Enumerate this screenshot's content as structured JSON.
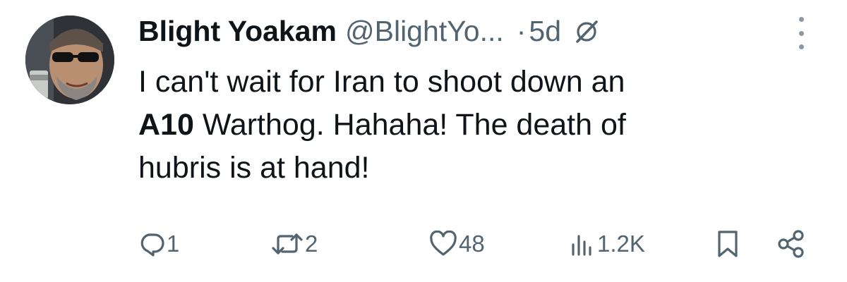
{
  "tweet": {
    "display_name": "Blight Yoakam",
    "handle": "@BlightYo...",
    "separator": "·",
    "time": "5d",
    "text": {
      "line1": "I can't wait for Iran to shoot down an",
      "bold": "A10",
      "line2_rest": " Warthog. Hahaha! The death of",
      "line3": "hubris is at hand!"
    },
    "icons": {
      "avatar": "avatar-photo",
      "badge": "slashed-circle-icon",
      "more": "more-dots-icon"
    }
  },
  "actions": {
    "reply": {
      "icon": "reply-icon",
      "count": "1"
    },
    "retweet": {
      "icon": "retweet-icon",
      "count": "2"
    },
    "like": {
      "icon": "heart-icon",
      "count": "48"
    },
    "views": {
      "icon": "views-chart-icon",
      "count": "1.2K"
    },
    "bookmark": {
      "icon": "bookmark-icon"
    },
    "share": {
      "icon": "share-icon"
    }
  },
  "colors": {
    "text": "#0f1419",
    "secondary": "#536471",
    "background": "#ffffff"
  }
}
